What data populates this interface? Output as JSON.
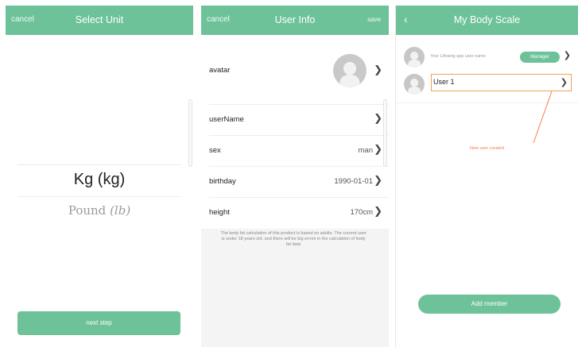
{
  "select_unit": {
    "cancel_label": "cancel",
    "title": "Select Unit",
    "option_primary": "Kg (kg)",
    "option_secondary_word": "Pound",
    "option_secondary_unit": "(lb)",
    "next_label": "next step"
  },
  "user_info": {
    "cancel_label": "cancel",
    "title": "User Info",
    "save_label": "save",
    "rows": [
      {
        "label": "avatar",
        "value": ""
      },
      {
        "label": "userName",
        "value": ""
      },
      {
        "label": "sex",
        "value": "man"
      },
      {
        "label": "birthday",
        "value": "1990-01-01"
      },
      {
        "label": "height",
        "value": "170cm"
      }
    ],
    "note": "The body fat calculation of this product is based on adults. The current user is under 18 years old, and there will be big errors in the calculation of body fat data"
  },
  "body_scale": {
    "back_icon": "chevron-left-icon",
    "title": "My Body Scale",
    "owner_name": "Your Lifesing app user name",
    "manager_badge": "Manager",
    "member_name": "User 1",
    "callout": "New user created",
    "add_label": "Add member"
  },
  "colors": {
    "accent": "#6dc29a",
    "highlight": "#f0a24e",
    "callout": "#f0814a"
  }
}
